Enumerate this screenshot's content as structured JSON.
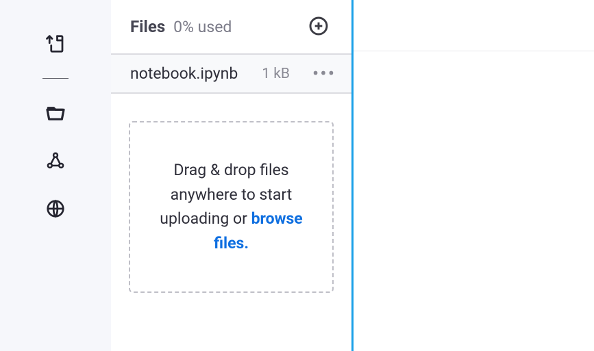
{
  "panel": {
    "title": "Files",
    "usage": "0% used"
  },
  "files": [
    {
      "name": "notebook.ipynb",
      "size": "1 kB"
    }
  ],
  "dropzone": {
    "text_before": "Drag & drop files anywhere to start uploading or ",
    "browse_label": "browse files."
  }
}
